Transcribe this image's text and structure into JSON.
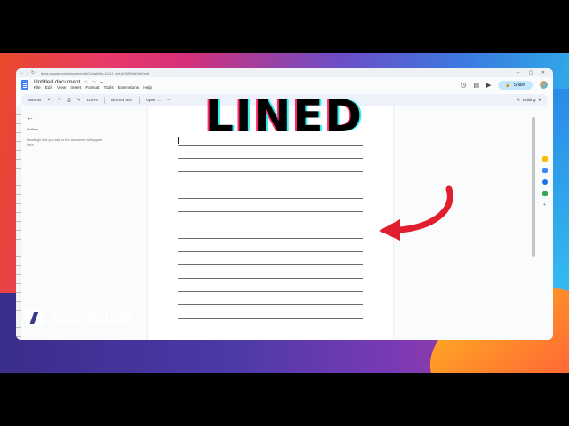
{
  "overlay": {
    "heading": "LINED",
    "brand": "AsapGuide"
  },
  "browser": {
    "url": "docs.google.com/document/d/1a1a6Ob-1VGJ_gnUsTWE0bKIr1f/edit"
  },
  "docs": {
    "title": "Untitled document",
    "menu": [
      "File",
      "Edit",
      "View",
      "Insert",
      "Format",
      "Tools",
      "Extensions",
      "Help"
    ],
    "share_label": "Share",
    "toolbar": {
      "search": "Menus",
      "zoom": "100%",
      "style": "Normal text",
      "font": "Open ...",
      "mode": "Editing"
    },
    "outline": {
      "heading": "Outline",
      "hint": "Headings that you add to the document will appear here."
    }
  },
  "colors": {
    "accent": "#4285f4",
    "arrow": "#e01e2e",
    "share_bg": "#c2e7ff"
  },
  "icons": [
    "back-arrow-icon",
    "star-icon",
    "folder-icon",
    "cloud-icon",
    "history-icon",
    "comment-icon",
    "video-icon",
    "lock-icon",
    "undo-icon",
    "redo-icon",
    "print-icon",
    "spellcheck-icon",
    "paint-format-icon"
  ]
}
